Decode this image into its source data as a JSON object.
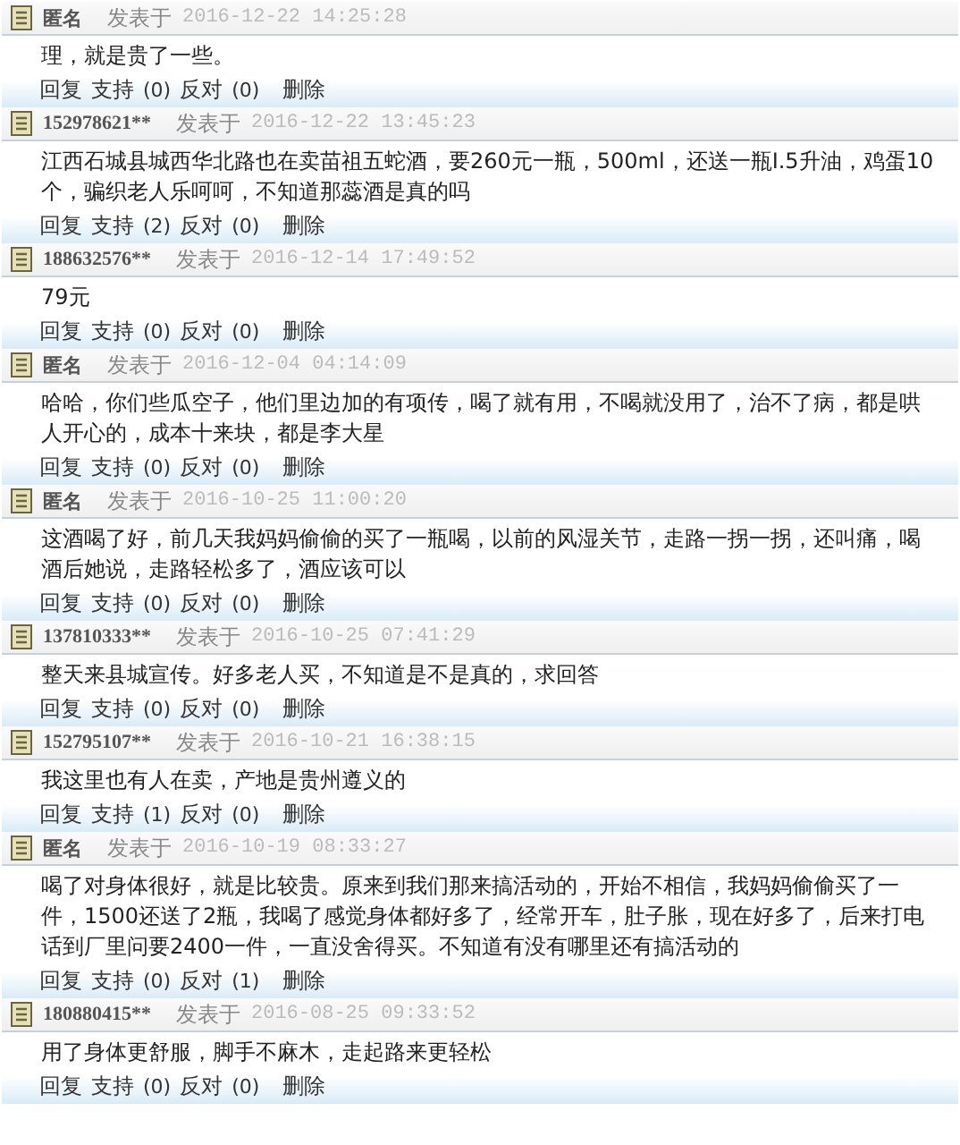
{
  "comments": [
    {
      "author": "匿名",
      "posted_label": "发表于",
      "date": "2016-12-22 14:25:28",
      "body": "理，就是贵了一些。",
      "actions": {
        "reply": "回复",
        "support": "支持",
        "support_count": "(0)",
        "oppose": "反对",
        "oppose_count": "(0)",
        "delete": "删除"
      }
    },
    {
      "author": "152978621**",
      "posted_label": "发表于",
      "date": "2016-12-22 13:45:23",
      "body": "江西石城县城西华北路也在卖苗祖五蛇酒，要260元一瓶，500ml，还送一瓶I.5升油，鸡蛋10个，骗织老人乐呵呵，不知道那蕊酒是真的吗",
      "actions": {
        "reply": "回复",
        "support": "支持",
        "support_count": "(2)",
        "oppose": "反对",
        "oppose_count": "(0)",
        "delete": "删除"
      }
    },
    {
      "author": "188632576**",
      "posted_label": "发表于",
      "date": "2016-12-14 17:49:52",
      "body": "79元",
      "actions": {
        "reply": "回复",
        "support": "支持",
        "support_count": "(0)",
        "oppose": "反对",
        "oppose_count": "(0)",
        "delete": "删除"
      }
    },
    {
      "author": "匿名",
      "posted_label": "发表于",
      "date": "2016-12-04 04:14:09",
      "body": "哈哈，你们些瓜空子，他们里边加的有项传，喝了就有用，不喝就没用了，治不了病，都是哄人开心的，成本十来块，都是李大星",
      "actions": {
        "reply": "回复",
        "support": "支持",
        "support_count": "(0)",
        "oppose": "反对",
        "oppose_count": "(0)",
        "delete": "删除"
      }
    },
    {
      "author": "匿名",
      "posted_label": "发表于",
      "date": "2016-10-25 11:00:20",
      "body": "这酒喝了好，前几天我妈妈偷偷的买了一瓶喝，以前的风湿关节，走路一拐一拐，还叫痛，喝酒后她说，走路轻松多了，酒应该可以",
      "actions": {
        "reply": "回复",
        "support": "支持",
        "support_count": "(0)",
        "oppose": "反对",
        "oppose_count": "(0)",
        "delete": "删除"
      }
    },
    {
      "author": "137810333**",
      "posted_label": "发表于",
      "date": "2016-10-25 07:41:29",
      "body": "整天来县城宣传。好多老人买，不知道是不是真的，求回答",
      "actions": {
        "reply": "回复",
        "support": "支持",
        "support_count": "(0)",
        "oppose": "反对",
        "oppose_count": "(0)",
        "delete": "删除"
      }
    },
    {
      "author": "152795107**",
      "posted_label": "发表于",
      "date": "2016-10-21 16:38:15",
      "body": "我这里也有人在卖，产地是贵州遵义的",
      "actions": {
        "reply": "回复",
        "support": "支持",
        "support_count": "(1)",
        "oppose": "反对",
        "oppose_count": "(0)",
        "delete": "删除"
      }
    },
    {
      "author": "匿名",
      "posted_label": "发表于",
      "date": "2016-10-19 08:33:27",
      "body": "喝了对身体很好，就是比较贵。原来到我们那来搞活动的，开始不相信，我妈妈偷偷买了一件，1500还送了2瓶，我喝了感觉身体都好多了，经常开车，肚子胀，现在好多了，后来打电话到厂里问要2400一件，一直没舍得买。不知道有没有哪里还有搞活动的",
      "actions": {
        "reply": "回复",
        "support": "支持",
        "support_count": "(0)",
        "oppose": "反对",
        "oppose_count": "(1)",
        "delete": "删除"
      }
    },
    {
      "author": "180880415**",
      "posted_label": "发表于",
      "date": "2016-08-25 09:33:52",
      "body": "用了身体更舒服，脚手不麻木，走起路来更轻松",
      "actions": {
        "reply": "回复",
        "support": "支持",
        "support_count": "(0)",
        "oppose": "反对",
        "oppose_count": "(0)",
        "delete": "删除"
      }
    }
  ]
}
